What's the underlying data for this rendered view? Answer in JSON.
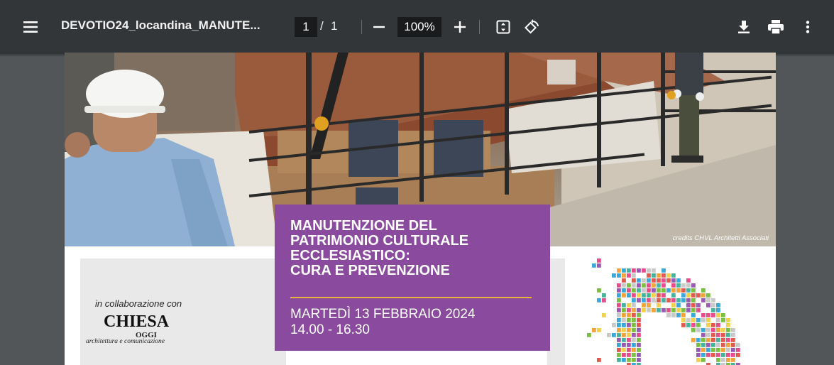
{
  "toolbar": {
    "filename": "DEVOTIO24_locandina_MANUTE...",
    "current_page": "1",
    "page_separator": "/",
    "total_pages": "1",
    "zoom": "100%",
    "icons": [
      "menu-icon",
      "zoom-out-icon",
      "zoom-in-icon",
      "fit-page-icon",
      "rotate-icon",
      "download-icon",
      "print-icon",
      "more-vert-icon"
    ]
  },
  "poster": {
    "credits": "credits CHVL Architetti Associati",
    "title_lines": [
      "MANUTENZIONE DEL",
      "PATRIMONIO CULTURALE",
      "ECCLESIASTICO:",
      "CURA E PREVENZIONE"
    ],
    "date": "MARTEDÌ 13 FEBBRAIO 2024",
    "time": "14.00 - 16.30",
    "collab": "in collaborazione con",
    "chiesa": "CHIESA",
    "oggi": "OGGI",
    "arch": "architettura e comunicazione",
    "accent_color": "#8a4b9e",
    "rule_color": "#e8b43a"
  }
}
